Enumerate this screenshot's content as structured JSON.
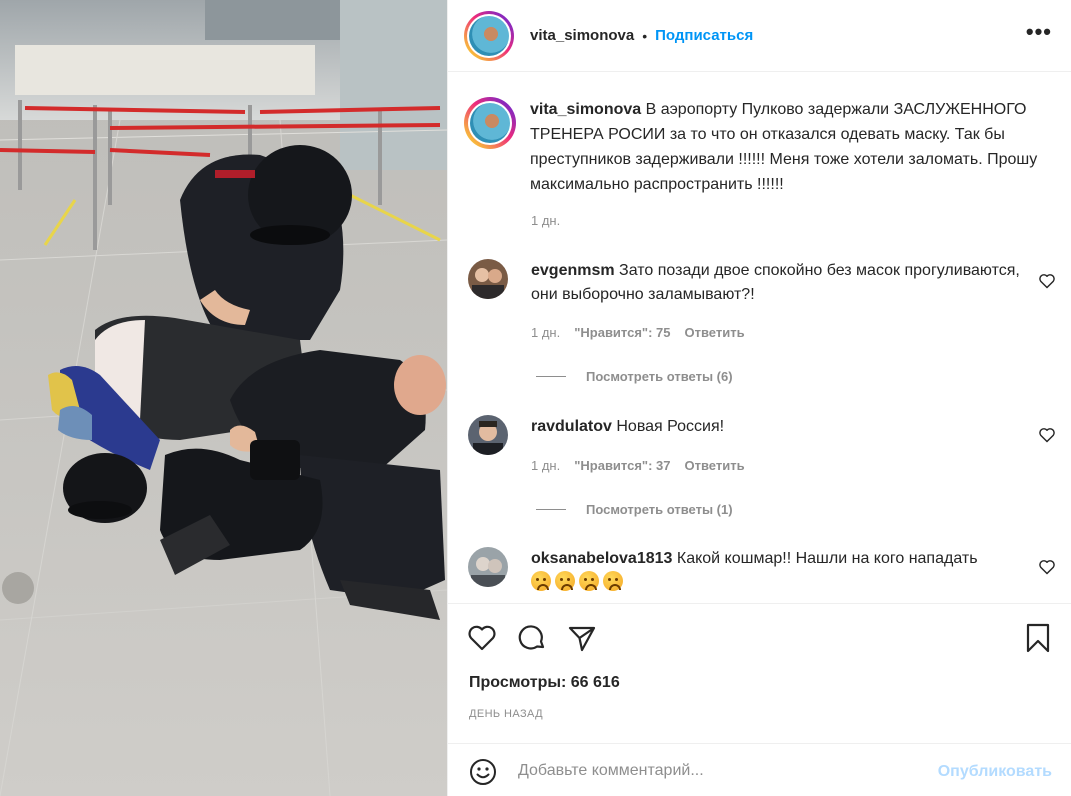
{
  "post": {
    "username": "vita_simonova",
    "dot": "•",
    "follow_label": "Подписаться",
    "more_label": "•••",
    "caption": "В аэропорту Пулково задержали ЗАСЛУЖЕННОГО ТРЕНЕРА РОСИИ за то что он отказался одевать маску. Так бы преступников задерживали !!!!!! Меня тоже хотели заломать. Прошу максимально распространить !!!!!!",
    "time": "1 дн."
  },
  "comments": [
    {
      "username": "evgenmsm",
      "text": "Зато позади двое спокойно без масок прогуливаются, они выборочно заламывают?!",
      "time": "1 дн.",
      "likes": "\"Нравится\": 75",
      "reply_label": "Ответить",
      "view_replies": "Посмотреть ответы (6)"
    },
    {
      "username": "ravdulatov",
      "text": "Новая Россия!",
      "time": "1 дн.",
      "likes": "\"Нравится\": 37",
      "reply_label": "Ответить",
      "view_replies": "Посмотреть ответы (1)"
    },
    {
      "username": "oksanabelova1813",
      "text": "Какой кошмар!! Нашли на кого нападать",
      "emoji": "😥😥😥😥"
    }
  ],
  "stats": {
    "views": "Просмотры: 66 616",
    "date": "ДЕНЬ НАЗАД"
  },
  "add_comment": {
    "placeholder": "Добавьте комментарий...",
    "publish_label": "Опубликовать"
  },
  "colors": {
    "accent": "#0095f6",
    "muted": "#8e8e8e",
    "publish_disabled": "#b3dbff"
  }
}
